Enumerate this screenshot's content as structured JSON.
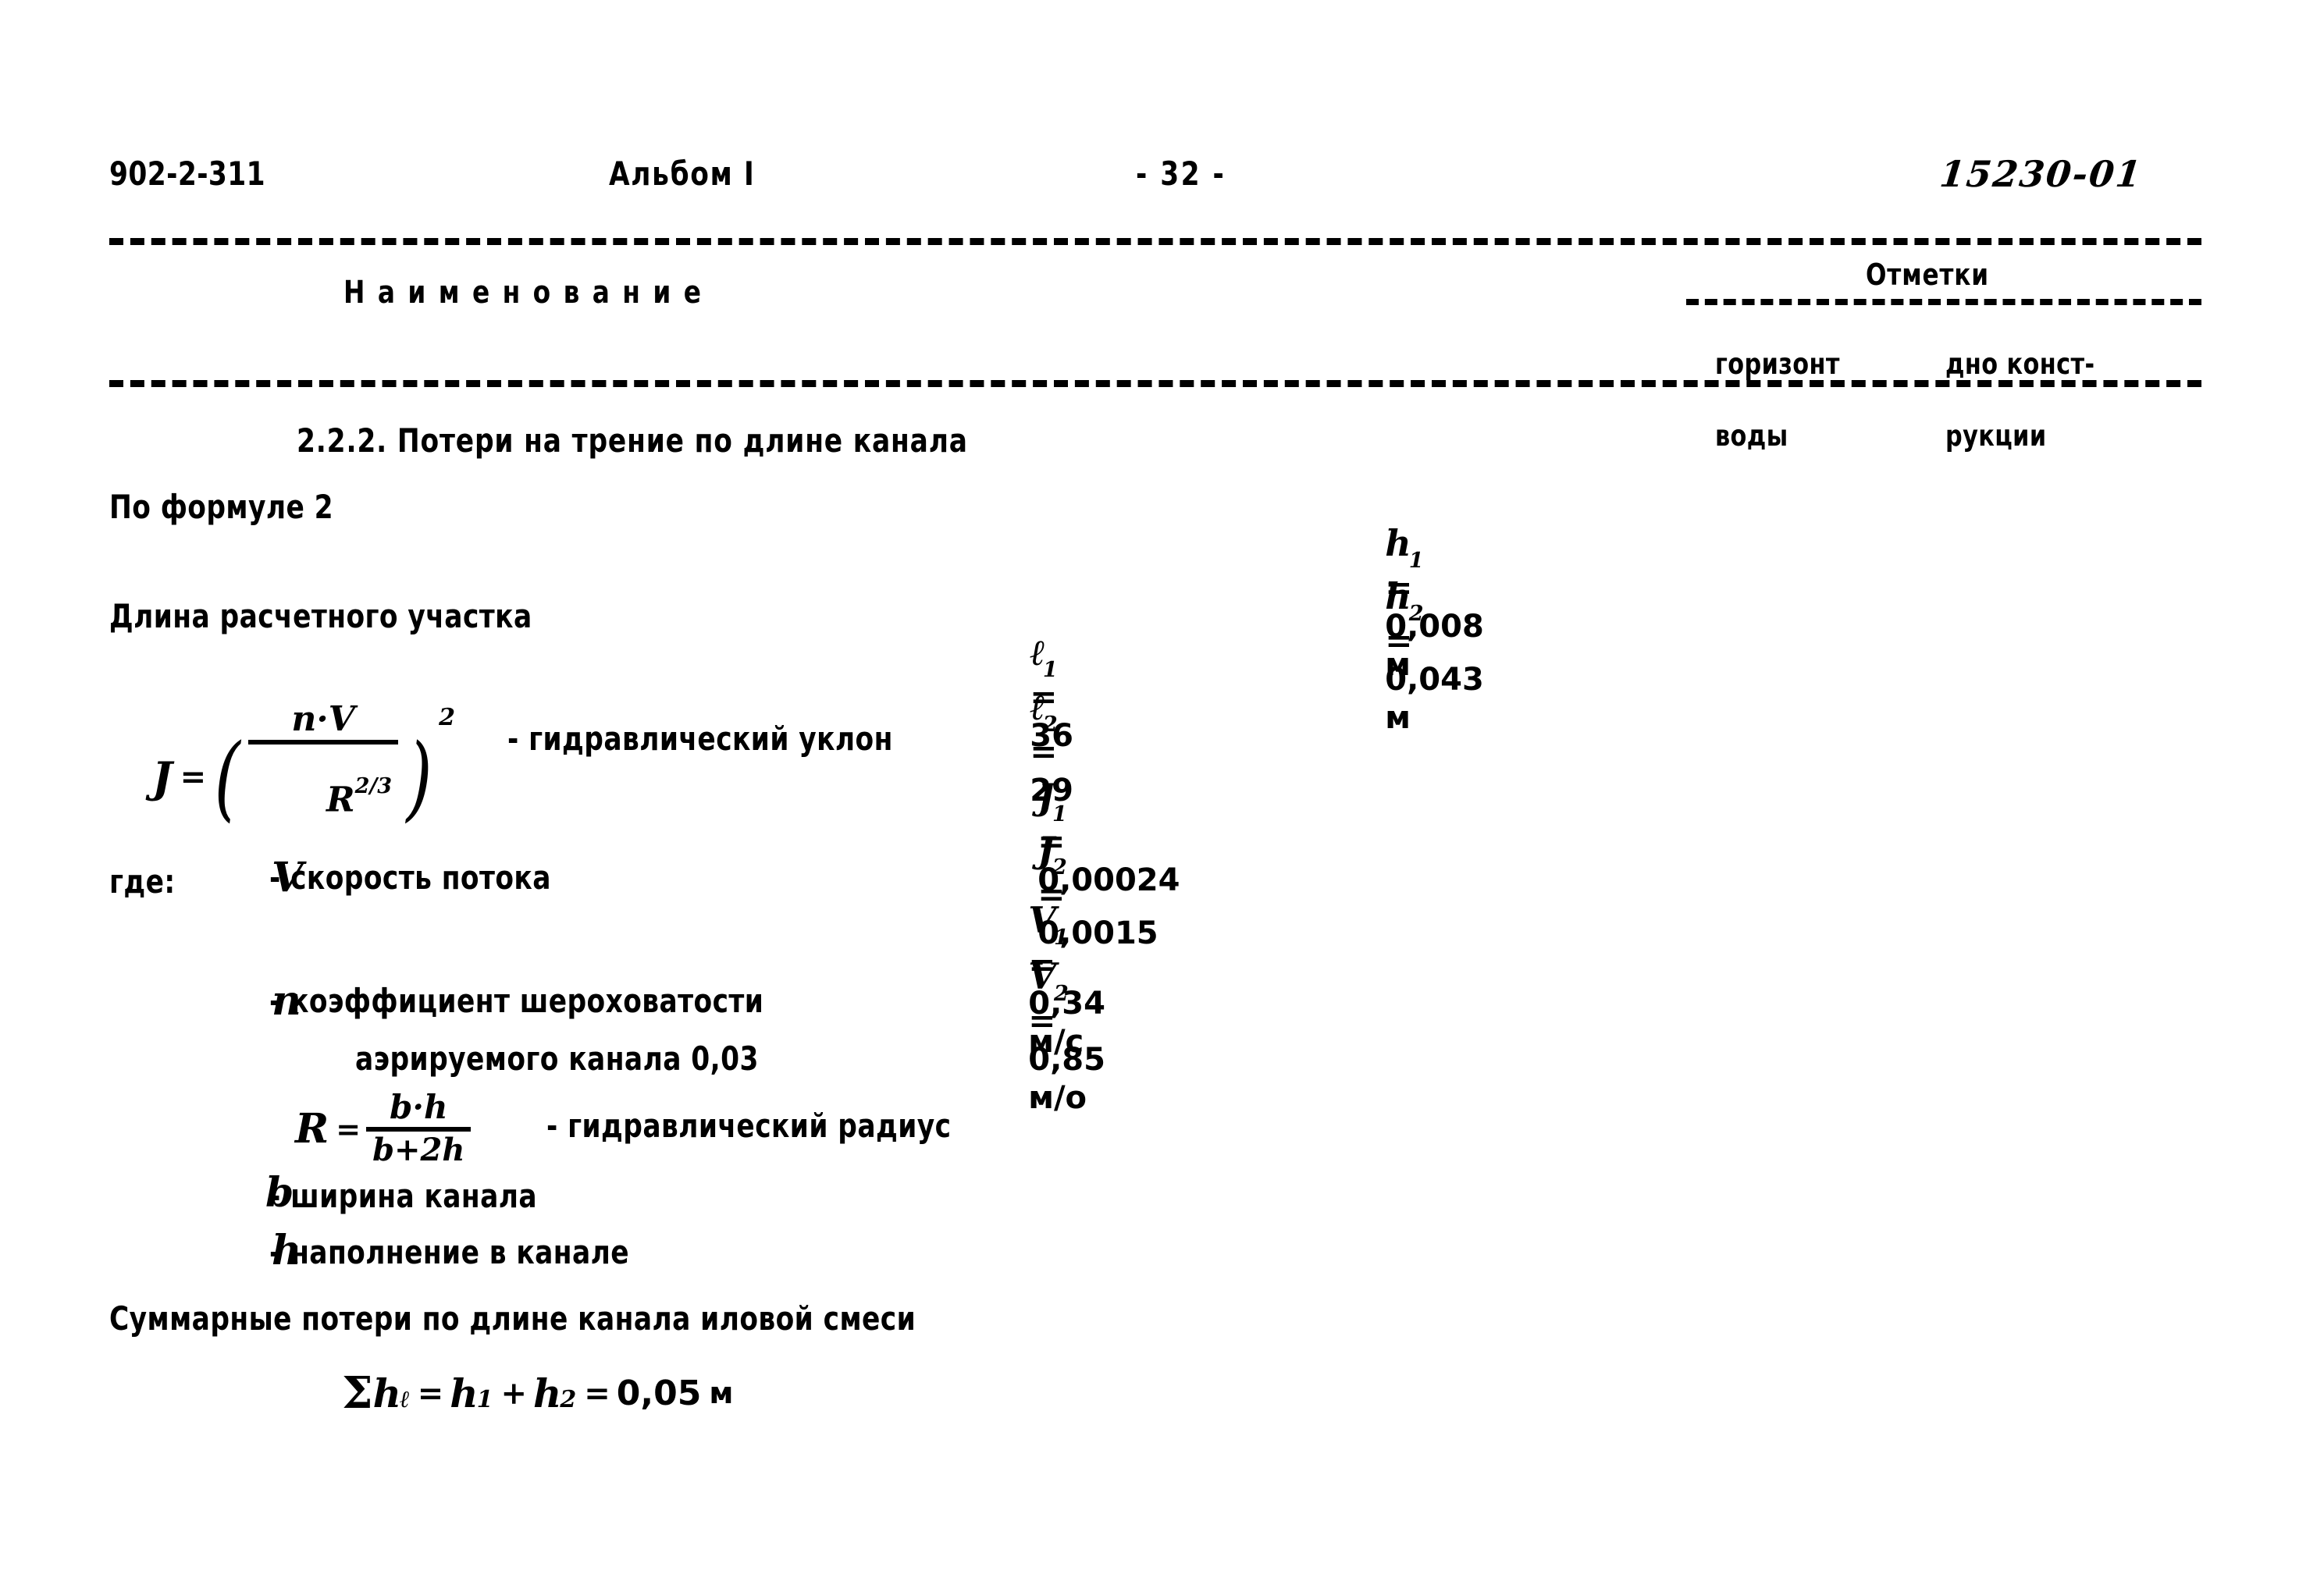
{
  "header": {
    "doc_code": "902-2-311",
    "album_title": "Альбом I",
    "page_number": "- 32 -",
    "sheet_number": "15230-01"
  },
  "table_header": {
    "name_column": "Наименование",
    "marks_group": "Отметки",
    "marks_col_1_line1": "горизонт",
    "marks_col_1_line2": "воды",
    "marks_col_2_line1": "дно конст-",
    "marks_col_2_line2": "рукции"
  },
  "body": {
    "section_title": "2.2.2. Потери на трение по длине канала",
    "by_formula": "По формуле 2",
    "length_label": "Длина расчетного участка",
    "j_caption": "- гидравлический уклон",
    "gde_label": "где:",
    "v_symbol": "V",
    "v_description": "- скорость потока",
    "n_symbol": "n",
    "n_description_line1": "- коэффициент шероховатости",
    "n_description_line2": "аэрируемого канала 0,03",
    "r_caption": "- гидравлический радиус",
    "b_symbol": "b",
    "b_description": "- ширина канала",
    "h_symbol": "h",
    "h_description": "- наполнение в канале",
    "summary_text": "Суммарные потери по длине канала иловой смеси"
  },
  "formulas": {
    "j": {
      "lhs": "J",
      "equals": "=",
      "numerator": "n·V",
      "denominator": "R",
      "denominator_exponent": "2/3",
      "outer_exponent": "2"
    },
    "r": {
      "lhs": "R",
      "equals": "=",
      "numerator": "b·h",
      "denominator": "b+2h"
    },
    "sum": {
      "sigma": "Σ",
      "h_sym": "h",
      "h_sub": "ℓ",
      "equals_1": "=",
      "term_1": "h",
      "term_1_sub": "1",
      "plus": "+",
      "term_2": "h",
      "term_2_sub": "2",
      "equals_2": "=",
      "value": "0,05",
      "unit": "м"
    }
  },
  "values": {
    "h1": {
      "sym": "h",
      "sub": "1",
      "eq": "=",
      "num": "0,008",
      "unit": "м"
    },
    "h2": {
      "sym": "h",
      "sub": "2",
      "eq": "=",
      "num": "0,043",
      "unit": "м"
    },
    "l1": {
      "sym": "ℓ",
      "sub": "1",
      "eq": "=",
      "num": "36",
      "unit": ""
    },
    "l2": {
      "sym": "ℓ",
      "sub": "2",
      "eq": "=",
      "num": "29",
      "unit": ""
    },
    "j1": {
      "sym": "J",
      "sub": "1",
      "eq": "=",
      "num": "0,00024",
      "unit": ""
    },
    "j2": {
      "sym": "J",
      "sub": "2",
      "eq": "=",
      "num": "0,0015",
      "unit": ""
    },
    "v1": {
      "sym": "V",
      "sub": "1",
      "eq": "=",
      "num": "0,34",
      "unit": "м/с"
    },
    "v2": {
      "sym": "V",
      "sub": "2",
      "eq": "=",
      "num": "0,85",
      "unit": "м/о"
    }
  }
}
